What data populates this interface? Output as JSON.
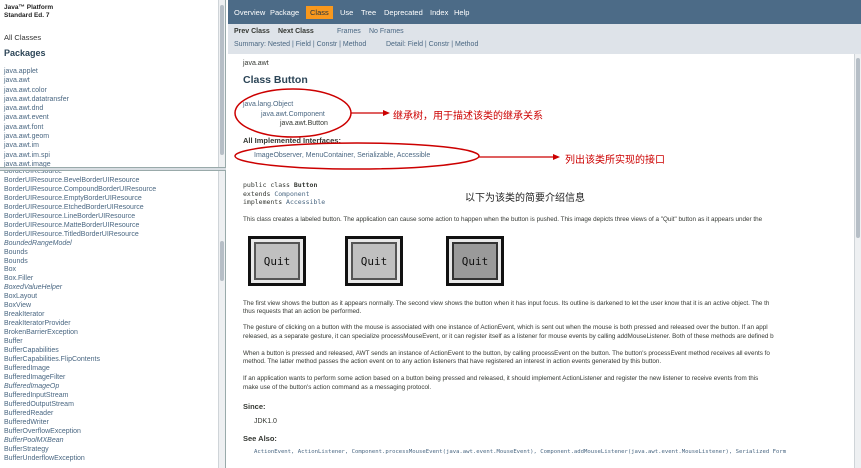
{
  "package_frame": {
    "platform_title_line1": "Java™ Platform",
    "platform_title_line2": "Standard Ed. 7",
    "all_classes": "All Classes",
    "packages_heading": "Packages",
    "packages": [
      "java.applet",
      "java.awt",
      "java.awt.color",
      "java.awt.datatransfer",
      "java.awt.dnd",
      "java.awt.event",
      "java.awt.font",
      "java.awt.geom",
      "java.awt.im",
      "java.awt.im.spi",
      "java.awt.image"
    ]
  },
  "class_frame": {
    "classes": [
      {
        "name": "BorderUIResource",
        "italic": false
      },
      {
        "name": "BorderUIResource.BevelBorderUIResource",
        "italic": false
      },
      {
        "name": "BorderUIResource.CompoundBorderUIResource",
        "italic": false
      },
      {
        "name": "BorderUIResource.EmptyBorderUIResource",
        "italic": false
      },
      {
        "name": "BorderUIResource.EtchedBorderUIResource",
        "italic": false
      },
      {
        "name": "BorderUIResource.LineBorderUIResource",
        "italic": false
      },
      {
        "name": "BorderUIResource.MatteBorderUIResource",
        "italic": false
      },
      {
        "name": "BorderUIResource.TitledBorderUIResource",
        "italic": false
      },
      {
        "name": "BoundedRangeModel",
        "italic": true
      },
      {
        "name": "Bounds",
        "italic": false
      },
      {
        "name": "Bounds",
        "italic": false
      },
      {
        "name": "Box",
        "italic": false
      },
      {
        "name": "Box.Filler",
        "italic": false
      },
      {
        "name": "BoxedValueHelper",
        "italic": true
      },
      {
        "name": "BoxLayout",
        "italic": false
      },
      {
        "name": "BoxView",
        "italic": false
      },
      {
        "name": "BreakIterator",
        "italic": false
      },
      {
        "name": "BreakIteratorProvider",
        "italic": false
      },
      {
        "name": "BrokenBarrierException",
        "italic": false
      },
      {
        "name": "Buffer",
        "italic": false
      },
      {
        "name": "BufferCapabilities",
        "italic": false
      },
      {
        "name": "BufferCapabilities.FlipContents",
        "italic": false
      },
      {
        "name": "BufferedImage",
        "italic": false
      },
      {
        "name": "BufferedImageFilter",
        "italic": false
      },
      {
        "name": "BufferedImageOp",
        "italic": true
      },
      {
        "name": "BufferedInputStream",
        "italic": false
      },
      {
        "name": "BufferedOutputStream",
        "italic": false
      },
      {
        "name": "BufferedReader",
        "italic": false
      },
      {
        "name": "BufferedWriter",
        "italic": false
      },
      {
        "name": "BufferOverflowException",
        "italic": false
      },
      {
        "name": "BufferPoolMXBean",
        "italic": true
      },
      {
        "name": "BufferStrategy",
        "italic": false
      },
      {
        "name": "BufferUnderflowException",
        "italic": false
      }
    ]
  },
  "top_nav": {
    "overview": "Overview",
    "package": "Package",
    "class": "Class",
    "use": "Use",
    "tree": "Tree",
    "deprecated": "Deprecated",
    "index": "Index",
    "help": "Help"
  },
  "sub_nav": {
    "prev_class": "Prev Class",
    "next_class": "Next Class",
    "frames": "Frames",
    "no_frames": "No Frames",
    "summary": "Summary: Nested | Field | Constr | Method",
    "detail": "Detail: Field | Constr | Method"
  },
  "doc": {
    "package_name": "java.awt",
    "class_title": "Class Button",
    "inheritance": [
      "java.lang.Object",
      "java.awt.Component",
      "java.awt.Button"
    ],
    "interfaces_heading": "All Implemented Interfaces:",
    "interfaces": "ImageObserver, MenuContainer, Serializable, Accessible",
    "decl_line1_kw": "public class ",
    "decl_line1_name": "Button",
    "decl_line2_kw": "extends ",
    "decl_line2_name": "Component",
    "decl_line3_kw": "implements ",
    "decl_line3_name": "Accessible",
    "intro": "This class creates a labeled button. The application can cause some action to happen when the button is pushed. This image depicts three views of a \"Quit\" button as it appears under the",
    "quit_label": "Quit",
    "para1_l1": "The first view shows the button as it appears normally. The second view shows the button when it has input focus. Its outline is darkened to let the user know that it is an active object. The th",
    "para1_l2": "thus requests that an action be performed.",
    "para2_l1": "The gesture of clicking on a button with the mouse is associated with one instance of ActionEvent, which is sent out when the mouse is both pressed and released over the button. If an appl",
    "para2_l2": "released, as a separate gesture, it can specialize processMouseEvent, or it can register itself as a listener for mouse events by calling addMouseListener. Both of these methods are defined b",
    "para3_l1": "When a button is pressed and released, AWT sends an instance of ActionEvent to the button, by calling processEvent on the button. The button's processEvent method receives all events fo",
    "para3_l2": "method. The latter method passes the action event on to any action listeners that have registered an interest in action events generated by this button.",
    "para4_l1": "If an application wants to perform some action based on a button being pressed and released, it should implement ActionListener and register the new listener to receive events from this",
    "para4_l2": "make use of the button's action command as a messaging protocol.",
    "since_heading": "Since:",
    "since_value": "JDK1.0",
    "see_also_heading": "See Also:",
    "see_also_value": "ActionEvent, ActionListener, Component.processMouseEvent(java.awt.event.MouseEvent), Component.addMouseListener(java.awt.event.MouseListener), Serialized Form"
  },
  "annotations": {
    "inheritance_note": "继承树，用于描述该类的继承关系",
    "interfaces_note": "列出该类所实现的接口",
    "intro_note": "以下为该类的简要介绍信息",
    "color": "#cc0000"
  }
}
